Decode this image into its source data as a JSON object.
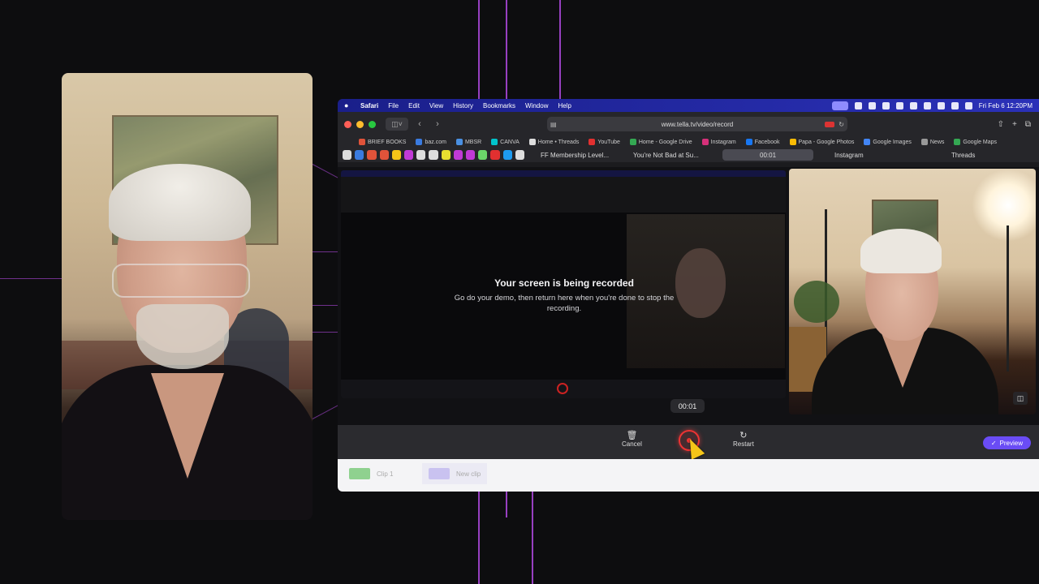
{
  "mac_menubar": {
    "app": "Safari",
    "menus": [
      "File",
      "Edit",
      "View",
      "History",
      "Bookmarks",
      "Window",
      "Help"
    ],
    "clock": "Fri Feb 6  12:20PM"
  },
  "browser": {
    "url": "www.tella.tv/video/record",
    "bookmarks": [
      {
        "label": "BRIEF BOOKS",
        "color": "#e0533a"
      },
      {
        "label": "baz.com",
        "color": "#3a7be0"
      },
      {
        "label": "MBSR",
        "color": "#4a90e2"
      },
      {
        "label": "CANVA",
        "color": "#00c4cc"
      },
      {
        "label": "Home • Threads",
        "color": "#dddddd"
      },
      {
        "label": "YouTube",
        "color": "#e23030"
      },
      {
        "label": "Home - Google Drive",
        "color": "#34a853"
      },
      {
        "label": "Instagram",
        "color": "#d6307a"
      },
      {
        "label": "Facebook",
        "color": "#1877f2"
      },
      {
        "label": "Papa - Google Photos",
        "color": "#fbbc05"
      },
      {
        "label": "Google Images",
        "color": "#4285f4"
      },
      {
        "label": "News",
        "color": "#999999"
      },
      {
        "label": "Google Maps",
        "color": "#34a853"
      }
    ],
    "tabs": [
      {
        "label": "FF Membership Level...",
        "active": false
      },
      {
        "label": "You're Not Bad at Su...",
        "active": false
      },
      {
        "label": "00:01",
        "active": true
      },
      {
        "label": "Instagram",
        "active": false
      },
      {
        "label": "Threads",
        "active": false
      }
    ]
  },
  "recording": {
    "heading": "Your screen is being recorded",
    "message": "Go do your demo, then return here when you're done to stop the recording.",
    "timer": "00:01"
  },
  "controls": {
    "cancel_label": "Cancel",
    "restart_label": "Restart",
    "preview_label": "Preview"
  },
  "clips": [
    {
      "label": "Clip 1",
      "color": "#8fd18f"
    },
    {
      "label": "New clip",
      "color": "#c9c2f0"
    }
  ]
}
